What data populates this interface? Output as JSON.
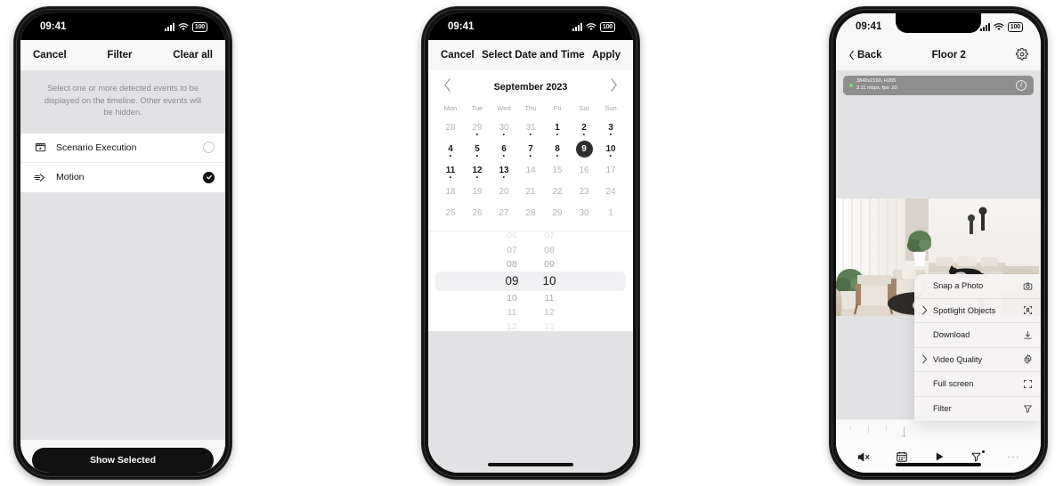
{
  "statusbar": {
    "time": "09:41",
    "battery": "100",
    "wifi_icon": "wifi-icon",
    "signal_icon": "cellular-signal-icon"
  },
  "phone1": {
    "nav": {
      "left": "Cancel",
      "title": "Filter",
      "right": "Clear all"
    },
    "hint": "Select one or more detected events to be displayed on the timeline. Other events will be hidden.",
    "options": [
      {
        "label": "Scenario Execution",
        "icon": "scenario-clapper-icon",
        "selected": false
      },
      {
        "label": "Motion",
        "icon": "motion-arrow-icon",
        "selected": true
      }
    ],
    "cta": "Show Selected"
  },
  "phone2": {
    "nav": {
      "left": "Cancel",
      "title": "Select Date and Time",
      "right": "Apply"
    },
    "calendar": {
      "month": "September 2023",
      "prev_icon": "chevron-left-icon",
      "next_icon": "chevron-right-icon",
      "weekdays": [
        "Mon",
        "Tue",
        "Wed",
        "Thu",
        "Fri",
        "Sat",
        "Sun"
      ],
      "selected_day": 9,
      "weeks": [
        [
          {
            "n": "28",
            "m": "out",
            "dot": false
          },
          {
            "n": "29",
            "m": "out",
            "dot": true
          },
          {
            "n": "30",
            "m": "out",
            "dot": true
          },
          {
            "n": "31",
            "m": "out",
            "dot": true
          },
          {
            "n": "1",
            "m": "in",
            "dot": true
          },
          {
            "n": "2",
            "m": "in",
            "dot": true
          },
          {
            "n": "3",
            "m": "in",
            "dot": true
          }
        ],
        [
          {
            "n": "4",
            "m": "in",
            "dot": true
          },
          {
            "n": "5",
            "m": "in",
            "dot": true
          },
          {
            "n": "6",
            "m": "in",
            "dot": true
          },
          {
            "n": "7",
            "m": "in",
            "dot": true
          },
          {
            "n": "8",
            "m": "in",
            "dot": true
          },
          {
            "n": "9",
            "m": "sel",
            "dot": false
          },
          {
            "n": "10",
            "m": "in",
            "dot": true
          }
        ],
        [
          {
            "n": "11",
            "m": "in",
            "dot": true
          },
          {
            "n": "12",
            "m": "in",
            "dot": true
          },
          {
            "n": "13",
            "m": "in",
            "dot": true
          },
          {
            "n": "14",
            "m": "dim",
            "dot": false
          },
          {
            "n": "15",
            "m": "dim",
            "dot": false
          },
          {
            "n": "16",
            "m": "dim",
            "dot": false
          },
          {
            "n": "17",
            "m": "dim",
            "dot": false
          }
        ],
        [
          {
            "n": "18",
            "m": "dim",
            "dot": false
          },
          {
            "n": "19",
            "m": "dim",
            "dot": false
          },
          {
            "n": "20",
            "m": "dim",
            "dot": false
          },
          {
            "n": "21",
            "m": "dim",
            "dot": false
          },
          {
            "n": "22",
            "m": "dim",
            "dot": false
          },
          {
            "n": "23",
            "m": "dim",
            "dot": false
          },
          {
            "n": "24",
            "m": "dim",
            "dot": false
          }
        ],
        [
          {
            "n": "25",
            "m": "dim",
            "dot": false
          },
          {
            "n": "26",
            "m": "dim",
            "dot": false
          },
          {
            "n": "27",
            "m": "dim",
            "dot": false
          },
          {
            "n": "28",
            "m": "dim",
            "dot": false
          },
          {
            "n": "29",
            "m": "dim",
            "dot": false
          },
          {
            "n": "30",
            "m": "dim",
            "dot": false
          },
          {
            "n": "1",
            "m": "out",
            "dot": false
          }
        ]
      ]
    },
    "timepicker": {
      "hours": {
        "selected": "09",
        "values": [
          "06",
          "07",
          "08",
          "09",
          "10",
          "11",
          "12"
        ]
      },
      "minutes": {
        "selected": "10",
        "values": [
          "07",
          "08",
          "09",
          "10",
          "11",
          "12",
          "13"
        ]
      }
    }
  },
  "phone3": {
    "nav": {
      "back": "Back",
      "title": "Floor 2",
      "back_icon": "chevron-left-icon",
      "settings_icon": "gear-icon"
    },
    "stream": {
      "line1": "3840x2160, H265",
      "line2": "3.11 mbps, fps: 20",
      "status_dot_color": "#7ae07a",
      "info_icon": "info-circle-icon"
    },
    "timeline_label": "13",
    "toolbar": [
      {
        "icon": "mute-speaker-icon",
        "badge": false
      },
      {
        "icon": "calendar-icon",
        "badge": false
      },
      {
        "icon": "play-icon",
        "badge": false
      },
      {
        "icon": "filter-icon",
        "badge": true
      },
      {
        "icon": "more-dots-icon",
        "badge": false
      }
    ],
    "context_menu": [
      {
        "label": "Snap a Photo",
        "icon": "camera-icon",
        "submenu": false
      },
      {
        "label": "Spotlight Objects",
        "icon": "spotlight-icon",
        "submenu": true
      },
      {
        "label": "Download",
        "icon": "download-icon",
        "submenu": false
      },
      {
        "label": "Video Quality",
        "icon": "gear-icon",
        "submenu": true
      },
      {
        "label": "Full screen",
        "icon": "fullscreen-icon",
        "submenu": false
      },
      {
        "label": "Filter",
        "icon": "filter-icon",
        "submenu": false
      }
    ]
  }
}
